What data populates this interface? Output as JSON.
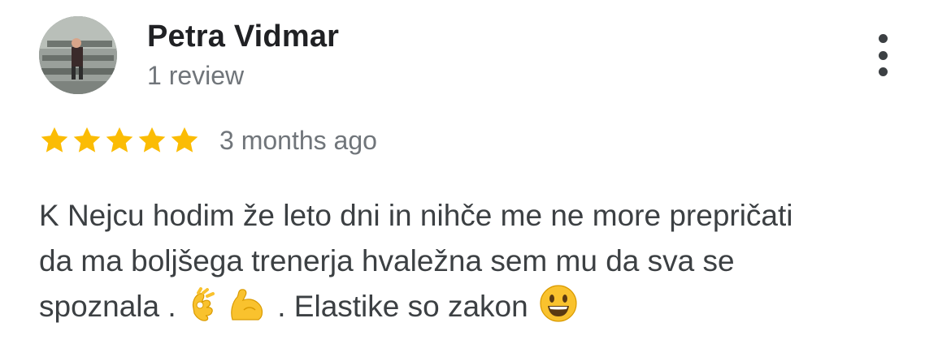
{
  "review": {
    "author_name": "Petra Vidmar",
    "review_count": "1 review",
    "rating": 5,
    "rating_max": 5,
    "date": "3 months ago",
    "text_lines": [
      "K Nejcu hodim že leto dni in nihče me ne more prepričati",
      "da ma boljšega trenerja hvaležna sem mu da sva se",
      "spoznala . ",
      " . Elastike so zakon "
    ],
    "emojis": [
      "ok-hand-emoji",
      "flexed-biceps-emoji",
      "smiley-emoji"
    ]
  },
  "colors": {
    "star": "#fbbc04",
    "name": "#202124",
    "secondary_text": "#70757a",
    "body_text": "#3c4043",
    "emoji_yellow": "#f9c22e"
  },
  "icons": {
    "menu": "more-vert-icon",
    "star": "star-icon"
  }
}
